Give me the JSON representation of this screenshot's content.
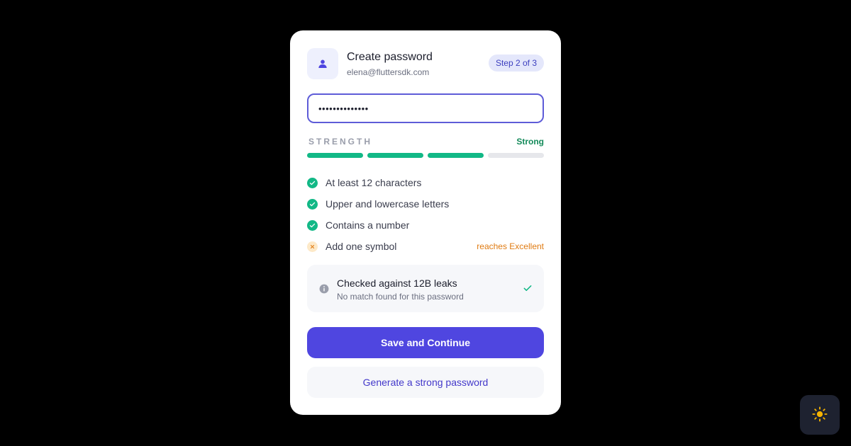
{
  "header": {
    "title": "Create password",
    "email": "elena@fluttersdk.com",
    "step": "Step 2 of 3",
    "avatar_icon": "user-icon"
  },
  "password": {
    "masked_value": "••••••••••••••",
    "type": "password"
  },
  "strength": {
    "label": "STRENGTH",
    "value": "Strong",
    "filled_segments": 3,
    "total_segments": 4,
    "value_color": "#138a5a",
    "filled_color": "#12b886"
  },
  "requirements": [
    {
      "label": "At least 12 characters",
      "met": true,
      "icon": "check-circle-icon"
    },
    {
      "label": "Upper and lowercase letters",
      "met": true,
      "icon": "check-circle-icon"
    },
    {
      "label": "Contains a number",
      "met": true,
      "icon": "check-circle-icon"
    },
    {
      "label": "Add one symbol",
      "met": false,
      "icon": "x-circle-icon",
      "hint": "reaches Excellent"
    }
  ],
  "leak_check": {
    "title": "Checked against 12B leaks",
    "subtitle": "No match found for this password",
    "info_icon": "info-icon",
    "status_icon": "check-icon"
  },
  "actions": {
    "primary_label": "Save and Continue",
    "secondary_label": "Generate a strong password"
  },
  "theme_toggle": {
    "icon": "sun-icon"
  },
  "colors": {
    "accent": "#4f46e0",
    "background": "#000000",
    "card": "#ffffff",
    "success": "#12b886",
    "warning": "#e07b12"
  }
}
